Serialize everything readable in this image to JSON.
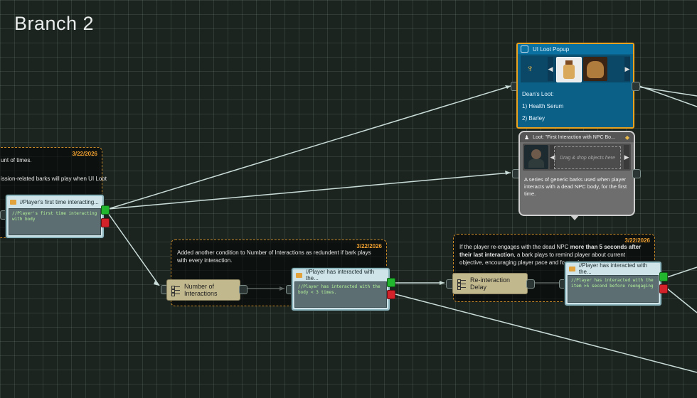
{
  "canvas": {
    "title": "Branch 2"
  },
  "comments": {
    "c1": {
      "date": "3/22/2026",
      "line1": "unt of times.",
      "line2": "ission-related barks will play when UI Loot"
    },
    "c2": {
      "date": "3/22/2026",
      "text": "Added another condition to Number of Interactions as redundent if bark plays with every interaction."
    },
    "c3": {
      "date": "3/22/2026",
      "text_pre": "If the player re-engages with the dead NPC ",
      "text_bold": "more than 5 seconds after their last interaction",
      "text_post": ", a bark plays to remind player about current objective, encouraging player pace and forward momentum."
    }
  },
  "bark_nodes": {
    "first": {
      "title": "//Player's first time interacting...",
      "body": "//Player's first time interacting with body"
    },
    "interacted": {
      "title": "//Player has interacted with the...",
      "body": "//Player has interacted with the body < 3 times."
    },
    "reengage": {
      "title": "//Player has interacted with the...",
      "body": "//Player has interacted with the item >5 second before reengaging"
    }
  },
  "condition_nodes": {
    "number": {
      "label": "Number of Interactions"
    },
    "delay": {
      "label": "Re-interaction Delay"
    }
  },
  "ui_loot_popup": {
    "title": "UI Loot Popup",
    "loot_heading": "Dean's Loot:",
    "items": [
      "1) Health Serum",
      "2) Barley"
    ]
  },
  "loot_node": {
    "title": "Loot: \"First Interaction with NPC Bo...",
    "drop_placeholder": "Drag & drop objects here",
    "description": "A series of generic barks used when player interacts with a dead NPC body, for the first time."
  },
  "colors": {
    "accent_orange": "#e9a321",
    "port_green": "#22b52e",
    "port_red": "#d4222a",
    "wire": "#c9dcd8"
  }
}
